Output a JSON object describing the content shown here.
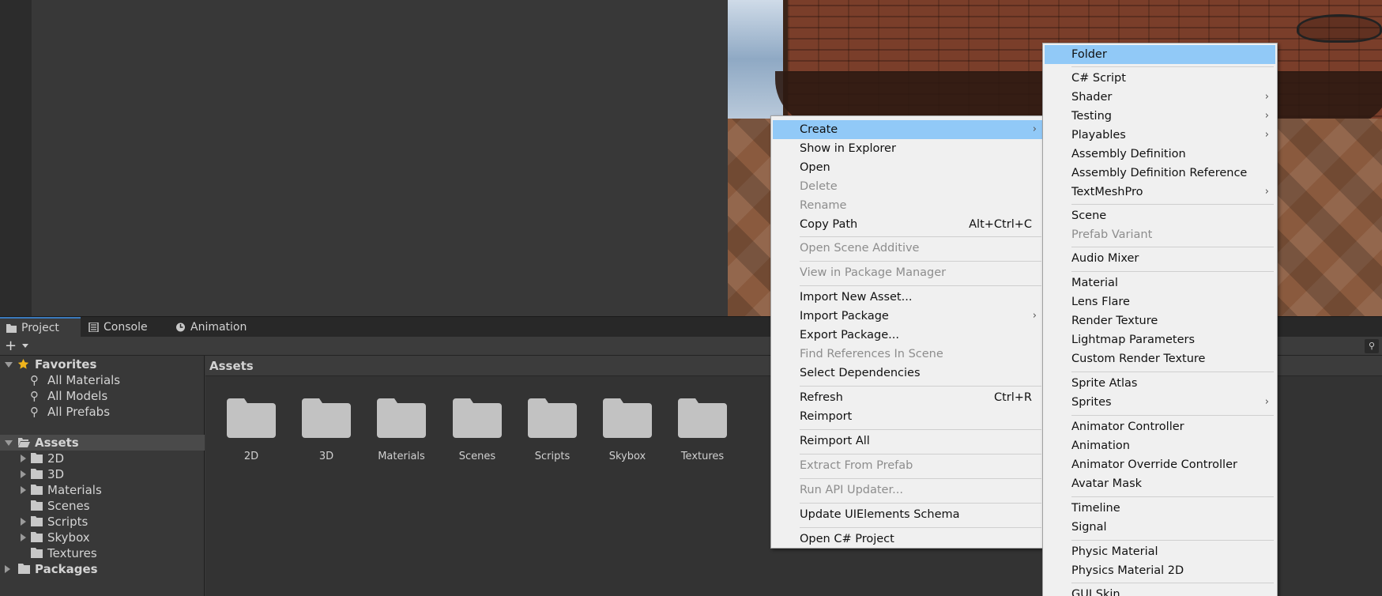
{
  "tabs": [
    {
      "label": "Project",
      "icon": "folder-icon",
      "active": true
    },
    {
      "label": "Console",
      "icon": "console-icon",
      "active": false
    },
    {
      "label": "Animation",
      "icon": "clock-icon",
      "active": false
    }
  ],
  "toolbar": {
    "create_label": "+",
    "search_icon": "search-icon"
  },
  "tree": {
    "favorites": {
      "label": "Favorites",
      "items": [
        "All Materials",
        "All Models",
        "All Prefabs"
      ]
    },
    "assets": {
      "label": "Assets",
      "children": [
        "2D",
        "3D",
        "Materials",
        "Scenes",
        "Scripts",
        "Skybox",
        "Textures"
      ]
    },
    "packages": {
      "label": "Packages"
    }
  },
  "content": {
    "header": "Assets",
    "folders": [
      "2D",
      "3D",
      "Materials",
      "Scenes",
      "Scripts",
      "Skybox",
      "Textures"
    ]
  },
  "context_menu": {
    "items": [
      {
        "label": "Create",
        "highlighted": true,
        "submenu": true
      },
      {
        "label": "Show in Explorer"
      },
      {
        "label": "Open"
      },
      {
        "label": "Delete",
        "disabled": true
      },
      {
        "label": "Rename",
        "disabled": true
      },
      {
        "label": "Copy Path",
        "shortcut": "Alt+Ctrl+C"
      },
      {
        "label": "Open Scene Additive",
        "disabled": true
      },
      {
        "label": "View in Package Manager",
        "disabled": true
      },
      {
        "label": "Import New Asset..."
      },
      {
        "label": "Import Package",
        "submenu": true
      },
      {
        "label": "Export Package..."
      },
      {
        "label": "Find References In Scene",
        "disabled": true
      },
      {
        "label": "Select Dependencies"
      },
      {
        "label": "Refresh",
        "shortcut": "Ctrl+R"
      },
      {
        "label": "Reimport"
      },
      {
        "label": "Reimport All"
      },
      {
        "label": "Extract From Prefab",
        "disabled": true
      },
      {
        "label": "Run API Updater...",
        "disabled": true
      },
      {
        "label": "Update UIElements Schema"
      },
      {
        "label": "Open C# Project"
      }
    ]
  },
  "create_submenu": {
    "items": [
      {
        "label": "Folder",
        "highlighted": true
      },
      {
        "label": "C# Script"
      },
      {
        "label": "Shader",
        "submenu": true
      },
      {
        "label": "Testing",
        "submenu": true
      },
      {
        "label": "Playables",
        "submenu": true
      },
      {
        "label": "Assembly Definition"
      },
      {
        "label": "Assembly Definition Reference"
      },
      {
        "label": "TextMeshPro",
        "submenu": true
      },
      {
        "label": "Scene"
      },
      {
        "label": "Prefab Variant",
        "disabled": true
      },
      {
        "label": "Audio Mixer"
      },
      {
        "label": "Material"
      },
      {
        "label": "Lens Flare"
      },
      {
        "label": "Render Texture"
      },
      {
        "label": "Lightmap Parameters"
      },
      {
        "label": "Custom Render Texture"
      },
      {
        "label": "Sprite Atlas"
      },
      {
        "label": "Sprites",
        "submenu": true
      },
      {
        "label": "Animator Controller"
      },
      {
        "label": "Animation"
      },
      {
        "label": "Animator Override Controller"
      },
      {
        "label": "Avatar Mask"
      },
      {
        "label": "Timeline"
      },
      {
        "label": "Signal"
      },
      {
        "label": "Physic Material"
      },
      {
        "label": "Physics Material 2D"
      },
      {
        "label": "GUI Skin"
      }
    ]
  },
  "colors": {
    "highlight": "#91c9f7",
    "menu_bg": "#f0f0f0",
    "panel_bg": "#383838",
    "active_tab_accent": "#3a79bb"
  }
}
